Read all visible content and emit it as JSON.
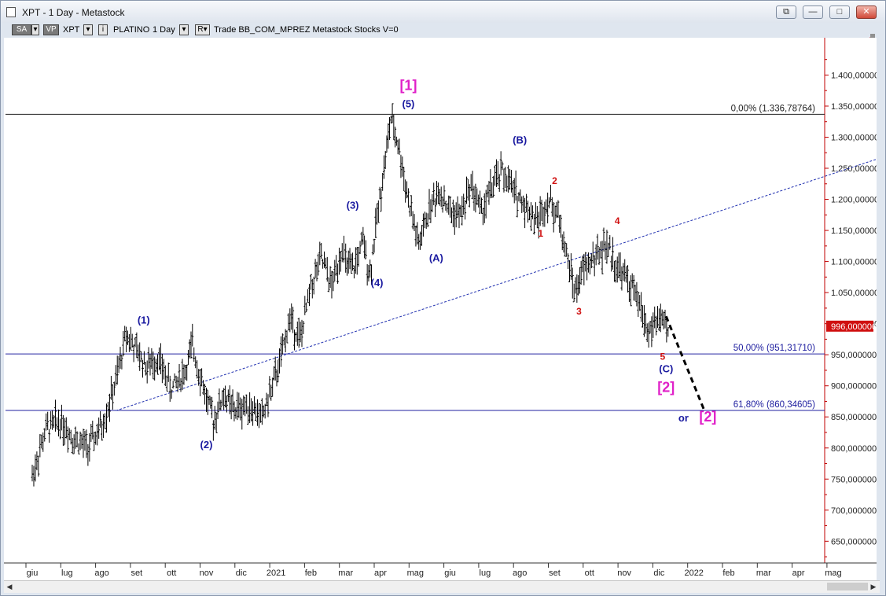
{
  "window": {
    "title": "XPT - 1 Day - Metastock",
    "buttons": {
      "restore": "⧉",
      "minimize": "—",
      "maximize": "□",
      "close": "✕"
    }
  },
  "toolbar": {
    "sa": "SA",
    "vp": "VP",
    "symbol": "XPT",
    "name": "PLATINO",
    "period": "1 Day",
    "r_label": "R",
    "text": "Trade  BB_COM_MPREZ  Metastock  Stocks  V=0"
  },
  "colors": {
    "blue_label": "#1a1aa0",
    "magenta_label": "#e020c8",
    "red_label": "#d01010",
    "price_tag": "#d01010",
    "fib_line": "#2020a0"
  },
  "chart_data": {
    "type": "ohlc-bar",
    "title": "",
    "ylim": [
      615,
      1460
    ],
    "y_ticks": [
      650,
      700,
      750,
      800,
      850,
      900,
      950,
      1000,
      1050,
      1100,
      1150,
      1200,
      1250,
      1300,
      1350,
      1400
    ],
    "y_tick_labels": [
      "650,000000",
      "700,000000",
      "750,000000",
      "800,000000",
      "850,000000",
      "900,000000",
      "950,000000",
      "1.000,000000",
      "1.050,000000",
      "1.100,000000",
      "1.150,000000",
      "1.200,000000",
      "1.250,000000",
      "1.300,000000",
      "1.350,000000",
      "1.400,000000"
    ],
    "months": [
      "giu",
      "lug",
      "ago",
      "set",
      "ott",
      "nov",
      "dic",
      "2021",
      "feb",
      "mar",
      "apr",
      "mag",
      "giu",
      "lug",
      "ago",
      "set",
      "ott",
      "nov",
      "dic",
      "2022",
      "feb",
      "mar",
      "apr",
      "mag"
    ],
    "last_price": 996,
    "last_price_label": "996,000000",
    "price_path": [
      [
        0,
        755
      ],
      [
        0.4,
        830
      ],
      [
        0.8,
        845
      ],
      [
        1.2,
        815
      ],
      [
        1.6,
        800
      ],
      [
        2.0,
        835
      ],
      [
        2.4,
        905
      ],
      [
        2.7,
        985
      ],
      [
        3.0,
        955
      ],
      [
        3.3,
        930
      ],
      [
        3.6,
        945
      ],
      [
        4.0,
        895
      ],
      [
        4.4,
        925
      ],
      [
        4.6,
        965
      ],
      [
        5.0,
        880
      ],
      [
        5.2,
        845
      ],
      [
        5.5,
        885
      ],
      [
        5.8,
        860
      ],
      [
        6.2,
        870
      ],
      [
        6.6,
        850
      ],
      [
        6.9,
        900
      ],
      [
        7.1,
        935
      ],
      [
        7.4,
        1010
      ],
      [
        7.7,
        975
      ],
      [
        8.0,
        1060
      ],
      [
        8.3,
        1105
      ],
      [
        8.6,
        1060
      ],
      [
        8.9,
        1125
      ],
      [
        9.0,
        1095
      ],
      [
        9.2,
        1085
      ],
      [
        9.5,
        1130
      ],
      [
        9.7,
        1080
      ],
      [
        9.9,
        1170
      ],
      [
        10.1,
        1250
      ],
      [
        10.3,
        1330
      ],
      [
        10.5,
        1290
      ],
      [
        10.8,
        1200
      ],
      [
        11.1,
        1125
      ],
      [
        11.4,
        1185
      ],
      [
        11.7,
        1215
      ],
      [
        12.0,
        1180
      ],
      [
        12.3,
        1175
      ],
      [
        12.6,
        1225
      ],
      [
        12.9,
        1180
      ],
      [
        13.2,
        1220
      ],
      [
        13.5,
        1245
      ],
      [
        13.8,
        1215
      ],
      [
        14.1,
        1195
      ],
      [
        14.5,
        1165
      ],
      [
        14.8,
        1200
      ],
      [
        15.1,
        1175
      ],
      [
        15.3,
        1120
      ],
      [
        15.6,
        1050
      ],
      [
        15.8,
        1085
      ],
      [
        16.1,
        1105
      ],
      [
        16.5,
        1125
      ],
      [
        16.8,
        1090
      ],
      [
        17.1,
        1070
      ],
      [
        17.4,
        1035
      ],
      [
        17.7,
        985
      ],
      [
        18.0,
        1010
      ],
      [
        18.3,
        980
      ]
    ],
    "projection": [
      [
        18.2,
        1012
      ],
      [
        19.3,
        860
      ]
    ],
    "horizontal_lines": [
      {
        "value": 1336.78764,
        "label": "0,00% (1.336,78764)",
        "color": "#222222"
      },
      {
        "value": 951.3171,
        "label": "50,00% (951,31710)",
        "color": "#2020a0"
      },
      {
        "value": 860.34605,
        "label": "61,80% (860,34605)",
        "color": "#2020a0"
      }
    ],
    "trendline": {
      "from": [
        2.4,
        860
      ],
      "to": [
        28.1,
        1336
      ],
      "style": "dotted"
    },
    "wave_labels": [
      {
        "text": "(1)",
        "x": 3.2,
        "y": 1000,
        "color": "blue"
      },
      {
        "text": "(2)",
        "x": 5.0,
        "y": 800,
        "color": "blue"
      },
      {
        "text": "(3)",
        "x": 9.2,
        "y": 1185,
        "color": "blue"
      },
      {
        "text": "(4)",
        "x": 9.9,
        "y": 1060,
        "color": "blue"
      },
      {
        "text": "(5)",
        "x": 10.8,
        "y": 1348,
        "color": "blue"
      },
      {
        "text": "[1]",
        "x": 10.8,
        "y": 1376,
        "color": "magenta"
      },
      {
        "text": "(A)",
        "x": 11.6,
        "y": 1100,
        "color": "blue"
      },
      {
        "text": "(B)",
        "x": 14.0,
        "y": 1290,
        "color": "blue"
      },
      {
        "text": "2",
        "x": 15.0,
        "y": 1225,
        "color": "red"
      },
      {
        "text": "1",
        "x": 14.6,
        "y": 1140,
        "color": "red"
      },
      {
        "text": "3",
        "x": 15.7,
        "y": 1015,
        "color": "red"
      },
      {
        "text": "4",
        "x": 16.8,
        "y": 1160,
        "color": "red"
      },
      {
        "text": "5",
        "x": 18.1,
        "y": 942,
        "color": "red"
      },
      {
        "text": "(C)",
        "x": 18.2,
        "y": 922,
        "color": "blue"
      },
      {
        "text": "[2]",
        "x": 18.2,
        "y": 890,
        "color": "magenta"
      },
      {
        "text": "or",
        "x": 18.7,
        "y": 843,
        "color": "blue"
      },
      {
        "text": "[2]",
        "x": 19.4,
        "y": 843,
        "color": "magenta"
      }
    ]
  }
}
